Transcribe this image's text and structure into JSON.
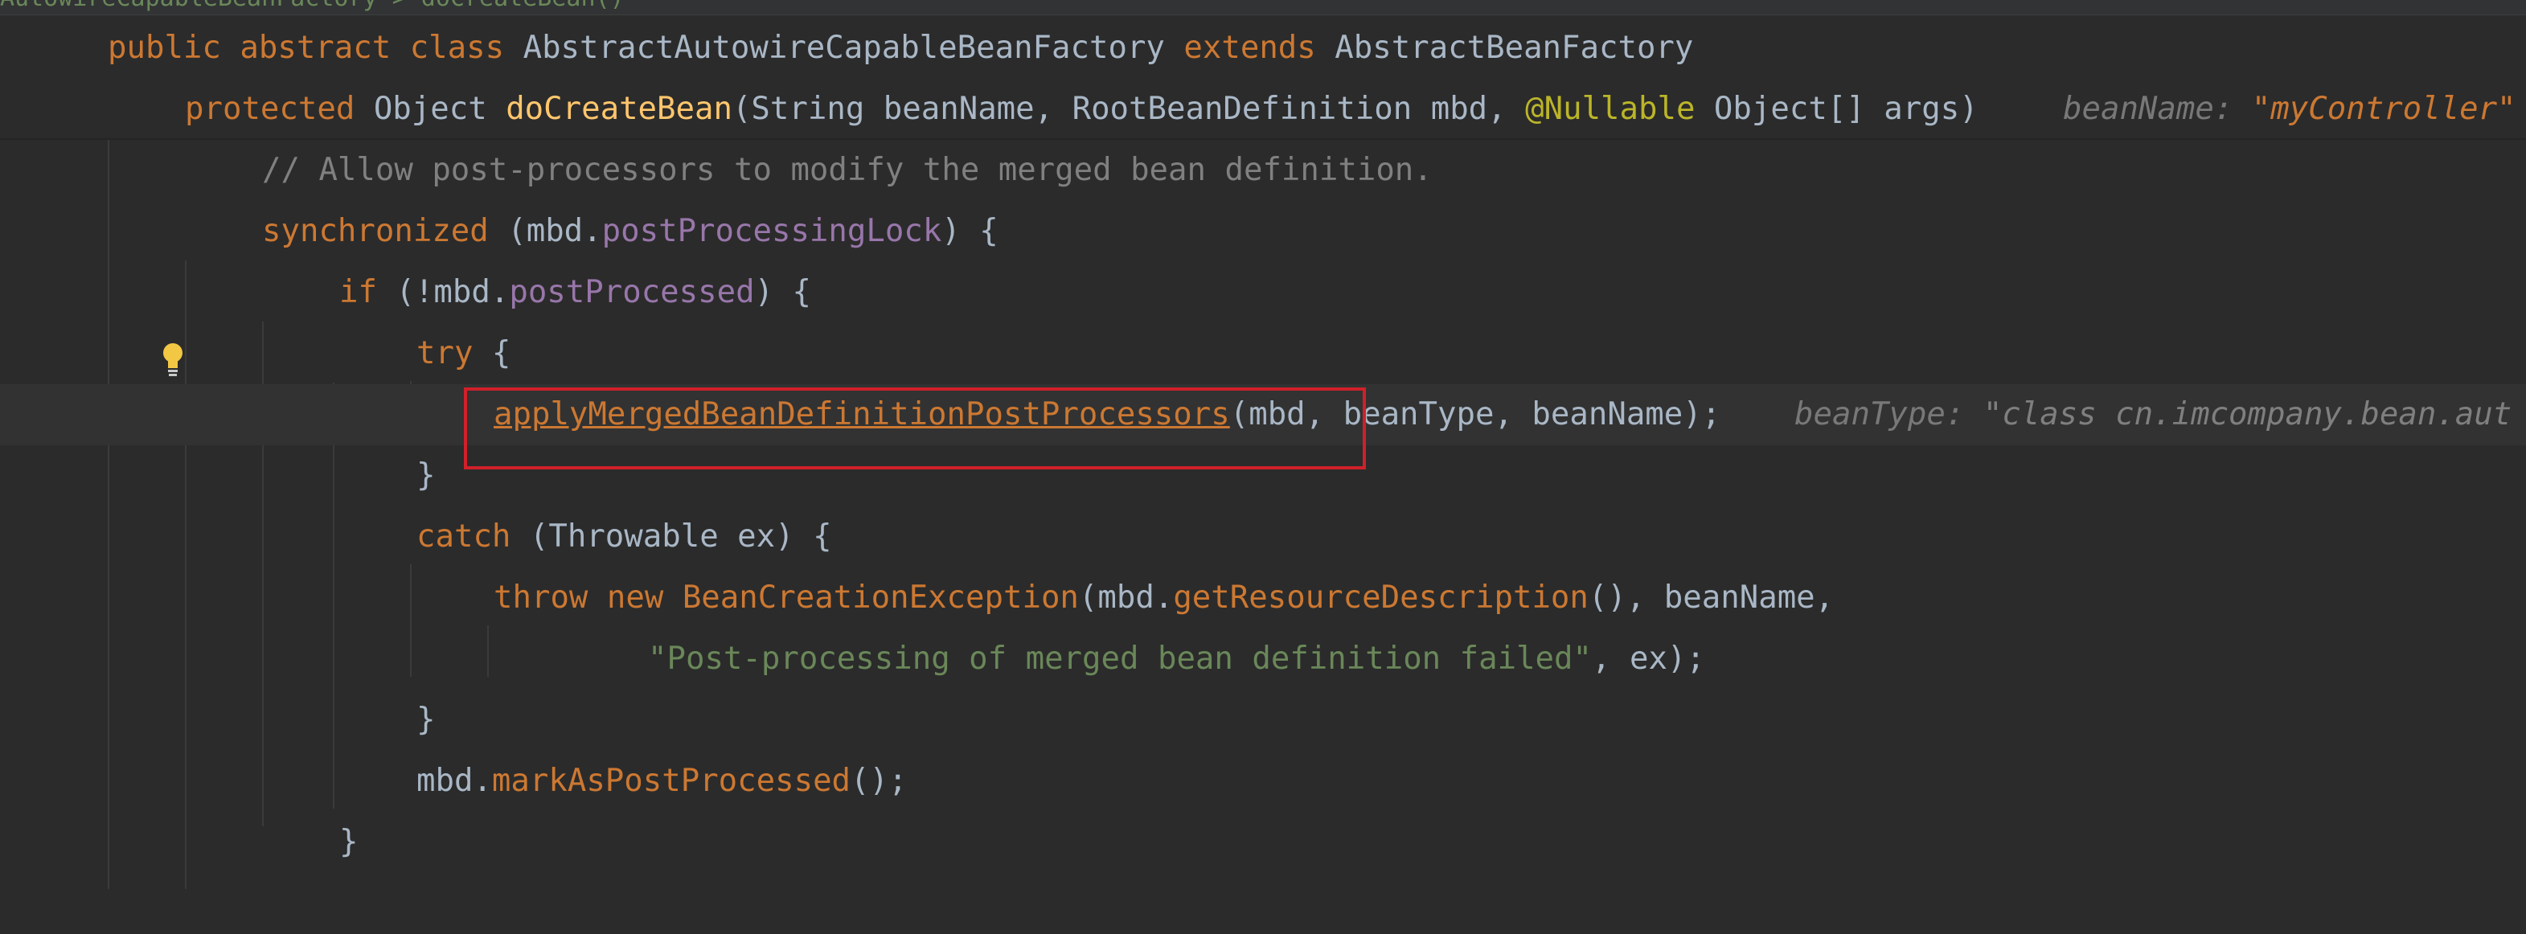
{
  "breadcrumb": "AutowireCapableBeanFactory  >  doCreateBean()",
  "colors": {
    "keyword": "#cc7832",
    "method": "#ffc66d",
    "field": "#9876aa",
    "string": "#6a8759",
    "comment": "#808080",
    "annotation": "#bbb529",
    "highlight_box": "#d0202a"
  },
  "code": {
    "l1": {
      "kw1": "public",
      "kw2": "abstract",
      "kw3": "class",
      "name": "AbstractAutowireCapableBeanFactory",
      "kw4": "extends",
      "parent": "AbstractBeanFactory"
    },
    "l2": {
      "kw": "protected",
      "type": "Object",
      "method": "doCreateBean",
      "params_a": "(String beanName, RootBeanDefinition mbd, ",
      "annotation": "@Nullable",
      "params_b": " Object[] args)",
      "inlay_label": "beanName: ",
      "inlay_value": "\"myController\""
    },
    "l3": {
      "comment": "// Allow post-processors to modify the merged bean definition."
    },
    "l4": {
      "kw": "synchronized",
      "a": " (mbd.",
      "field": "postProcessingLock",
      "b": ") {"
    },
    "l5": {
      "kw": "if",
      "a": " (!mbd.",
      "field": "postProcessed",
      "b": ") {"
    },
    "l6": {
      "kw": "try",
      "a": " {"
    },
    "l7": {
      "method": "applyMergedBeanDefinitionPostProcessors",
      "args": "(mbd, beanType, beanName);",
      "inlay_label": "beanType: ",
      "inlay_value": "\"class cn.imcompany.bean.aut"
    },
    "l8": {
      "text": "}"
    },
    "l9": {
      "kw": "catch",
      "a": " (Throwable ex) {"
    },
    "l10": {
      "kw1": "throw",
      "kw2": "new",
      "cls": "BeanCreationException",
      "a": "(mbd.",
      "method": "getResourceDescription",
      "b": "(), beanName,"
    },
    "l11": {
      "str": "\"Post-processing of merged bean definition failed\"",
      "a": ", ex);"
    },
    "l12": {
      "text": "}"
    },
    "l13": {
      "a": "mbd.",
      "method": "markAsPostProcessed",
      "b": "();"
    },
    "l14": {
      "text": "}"
    }
  }
}
